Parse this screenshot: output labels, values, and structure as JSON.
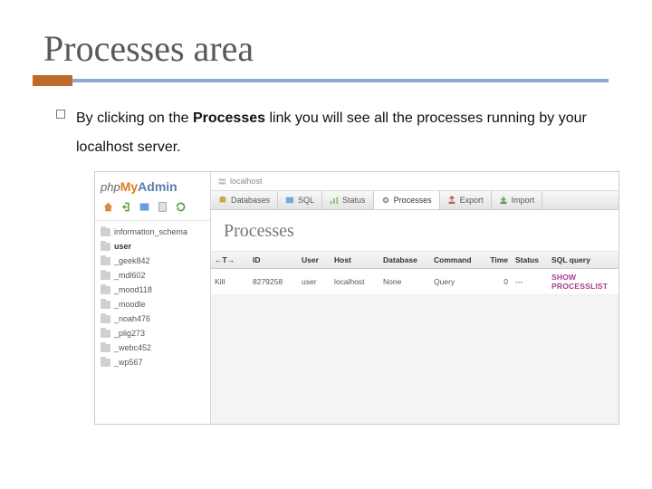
{
  "slide": {
    "title": "Processes area",
    "body_prefix": "By clicking on the ",
    "body_bold": "Processes",
    "body_suffix": " link you will see all the processes running by your localhost server."
  },
  "pma": {
    "logo": {
      "php": "php",
      "my": "My",
      "admin": "Admin"
    },
    "breadcrumb": "localhost",
    "sidebar": [
      {
        "label": "information_schema",
        "active": false
      },
      {
        "label": "user",
        "active": true
      },
      {
        "label": "_geek842",
        "active": false
      },
      {
        "label": "_mdl602",
        "active": false
      },
      {
        "label": "_mood118",
        "active": false
      },
      {
        "label": "_moodle",
        "active": false
      },
      {
        "label": "_noah476",
        "active": false
      },
      {
        "label": "_plig273",
        "active": false
      },
      {
        "label": "_webc452",
        "active": false
      },
      {
        "label": "_wp567",
        "active": false
      }
    ],
    "tabs": [
      {
        "label": "Databases",
        "active": false
      },
      {
        "label": "SQL",
        "active": false
      },
      {
        "label": "Status",
        "active": false
      },
      {
        "label": "Processes",
        "active": true
      },
      {
        "label": "Export",
        "active": false
      },
      {
        "label": "Import",
        "active": false
      }
    ],
    "page_heading": "Processes",
    "thead": {
      "arrow": "←T→",
      "id": "ID",
      "user": "User",
      "host": "Host",
      "db": "Database",
      "cmd": "Command",
      "time": "Time",
      "status": "Status",
      "sql": "SQL query"
    },
    "row": {
      "action": "Kill",
      "id": "8279258",
      "user": "user",
      "host": "localhost",
      "db": "None",
      "cmd": "Query",
      "time": "0",
      "status": "---",
      "sql": "SHOW PROCESSLIST"
    }
  }
}
